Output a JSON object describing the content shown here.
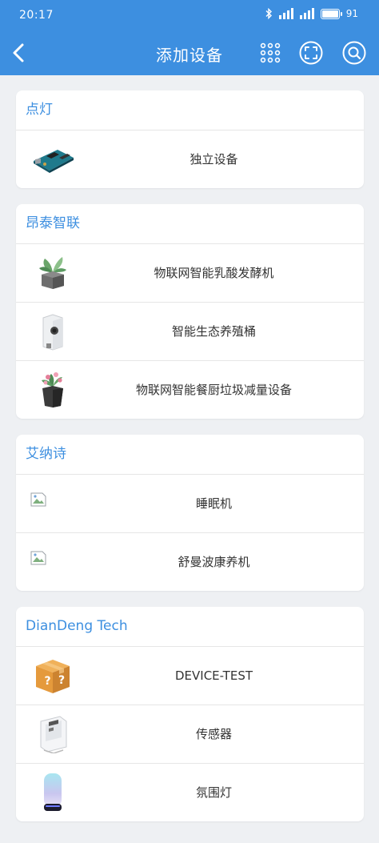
{
  "status": {
    "time": "20:17",
    "battery": "91"
  },
  "nav": {
    "title": "添加设备"
  },
  "sections": [
    {
      "title": "点灯",
      "items": [
        {
          "label": "独立设备"
        }
      ]
    },
    {
      "title": "昂泰智联",
      "items": [
        {
          "label": "物联网智能乳酸发酵机"
        },
        {
          "label": "智能生态养殖桶"
        },
        {
          "label": "物联网智能餐厨垃圾减量设备"
        }
      ]
    },
    {
      "title": "艾纳诗",
      "items": [
        {
          "label": "睡眠机"
        },
        {
          "label": "舒曼波康养机"
        }
      ]
    },
    {
      "title": "DianDeng Tech",
      "items": [
        {
          "label": "DEVICE-TEST"
        },
        {
          "label": "传感器"
        },
        {
          "label": "氛围灯"
        }
      ]
    }
  ],
  "colors": {
    "accent": "#3d8fe0",
    "background": "#eef0f3"
  }
}
